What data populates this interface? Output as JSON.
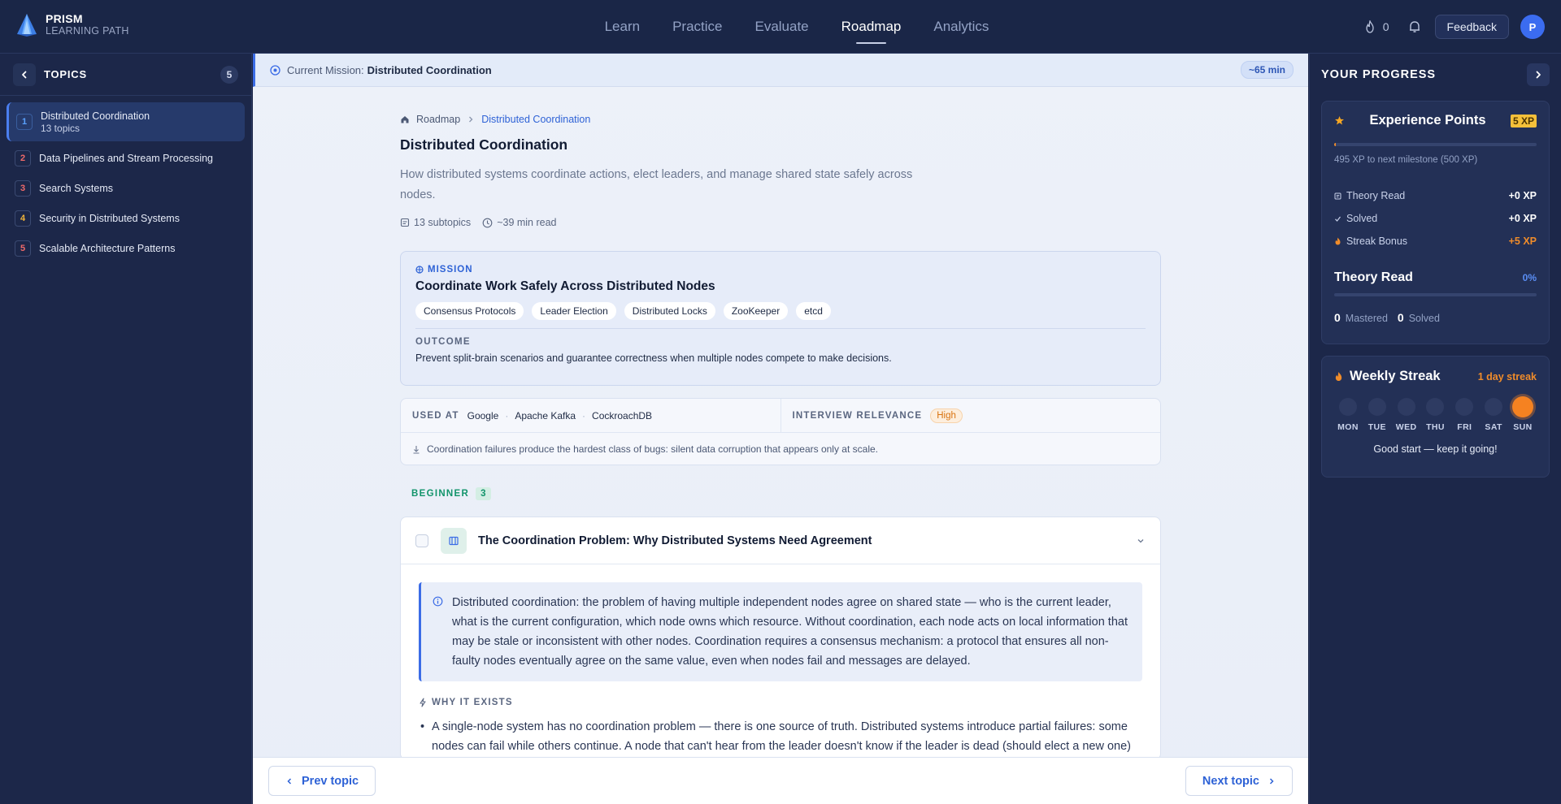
{
  "app": {
    "title": "PRISM",
    "subtitle": "LEARNING PATH"
  },
  "nav": {
    "items": [
      {
        "label": "Learn"
      },
      {
        "label": "Practice"
      },
      {
        "label": "Evaluate"
      },
      {
        "label": "Roadmap"
      },
      {
        "label": "Analytics"
      }
    ],
    "active": "Roadmap",
    "flame_count": "0",
    "feedback_label": "Feedback",
    "avatar_initial": "P"
  },
  "sidebar": {
    "title": "TOPICS",
    "count": "5",
    "topics": [
      {
        "num": "1",
        "label": "Distributed Coordination",
        "sub": "13 topics",
        "color": "#5aa2ff"
      },
      {
        "num": "2",
        "label": "Data Pipelines and Stream Processing",
        "color": "#f06a6a"
      },
      {
        "num": "3",
        "label": "Search Systems",
        "color": "#f06a6a"
      },
      {
        "num": "4",
        "label": "Security in Distributed Systems",
        "color": "#f0b43a"
      },
      {
        "num": "5",
        "label": "Scalable Architecture Patterns",
        "color": "#f06a6a"
      }
    ]
  },
  "mission_strip": {
    "label": "Current Mission:",
    "value": "Distributed Coordination",
    "time": "~65 min"
  },
  "breadcrumb": {
    "root": "Roadmap",
    "current": "Distributed Coordination"
  },
  "page": {
    "title": "Distributed Coordination",
    "description": "How distributed systems coordinate actions, elect leaders, and manage shared state safely across nodes.",
    "subtopics": "13 subtopics",
    "read_time": "~39 min read"
  },
  "mission": {
    "kicker": "MISSION",
    "title": "Coordinate Work Safely Across Distributed Nodes",
    "tags": [
      "Consensus Protocols",
      "Leader Election",
      "Distributed Locks",
      "ZooKeeper",
      "etcd"
    ],
    "outcome_label": "OUTCOME",
    "outcome": "Prevent split-brain scenarios and guarantee correctness when multiple nodes compete to make decisions."
  },
  "info": {
    "used_at_label": "USED AT",
    "companies": [
      "Google",
      "Apache Kafka",
      "CockroachDB"
    ],
    "relevance_label": "INTERVIEW RELEVANCE",
    "relevance": "High",
    "note": "Coordination failures produce the hardest class of bugs: silent data corruption that appears only at scale."
  },
  "level": {
    "label": "BEGINNER",
    "count": "3"
  },
  "subtopic": {
    "title": "The Coordination Problem: Why Distributed Systems Need Agreement",
    "callout": "Distributed coordination: the problem of having multiple independent nodes agree on shared state — who is the current leader, what is the current configuration, which node owns which resource. Without coordination, each node acts on local information that may be stale or inconsistent with other nodes. Coordination requires a consensus mechanism: a protocol that ensures all non-faulty nodes eventually agree on the same value, even when nodes fail and messages are delayed.",
    "why_label": "WHY IT EXISTS",
    "bullet": "A single-node system has no coordination problem — there is one source of truth. Distributed systems introduce partial failures: some nodes can fail while others continue. A node that can't hear from the leader doesn't know if the leader is dead (should elect a new one)"
  },
  "footer": {
    "prev_label": "Prev topic",
    "next_label": "Next topic"
  },
  "progress": {
    "title": "YOUR PROGRESS",
    "xp_title": "Experience Points",
    "xp_badge": "5 XP",
    "xp_fraction": 0.01,
    "xp_note": "495 XP to next milestone (500 XP)",
    "rows": [
      {
        "label": "Theory Read",
        "value": "+0 XP"
      },
      {
        "label": "Solved",
        "value": "+0 XP"
      },
      {
        "label": "Streak Bonus",
        "value": "+5 XP"
      }
    ],
    "theory_title": "Theory Read",
    "theory_pct": "0%",
    "mastered_count": "0",
    "mastered_label": "Mastered",
    "solved_count": "0",
    "solved_label": "Solved"
  },
  "streak": {
    "title": "Weekly Streak",
    "count": "1 day streak",
    "days": [
      {
        "label": "MON",
        "active": false
      },
      {
        "label": "TUE",
        "active": false
      },
      {
        "label": "WED",
        "active": false
      },
      {
        "label": "THU",
        "active": false
      },
      {
        "label": "FRI",
        "active": false
      },
      {
        "label": "SAT",
        "active": false
      },
      {
        "label": "SUN",
        "active": true
      }
    ],
    "message": "Good start — keep it going!"
  },
  "colors": {
    "accent": "#3b6ce6",
    "orange": "#f08c2a",
    "green": "#12946b",
    "navy": "#1c2749"
  }
}
